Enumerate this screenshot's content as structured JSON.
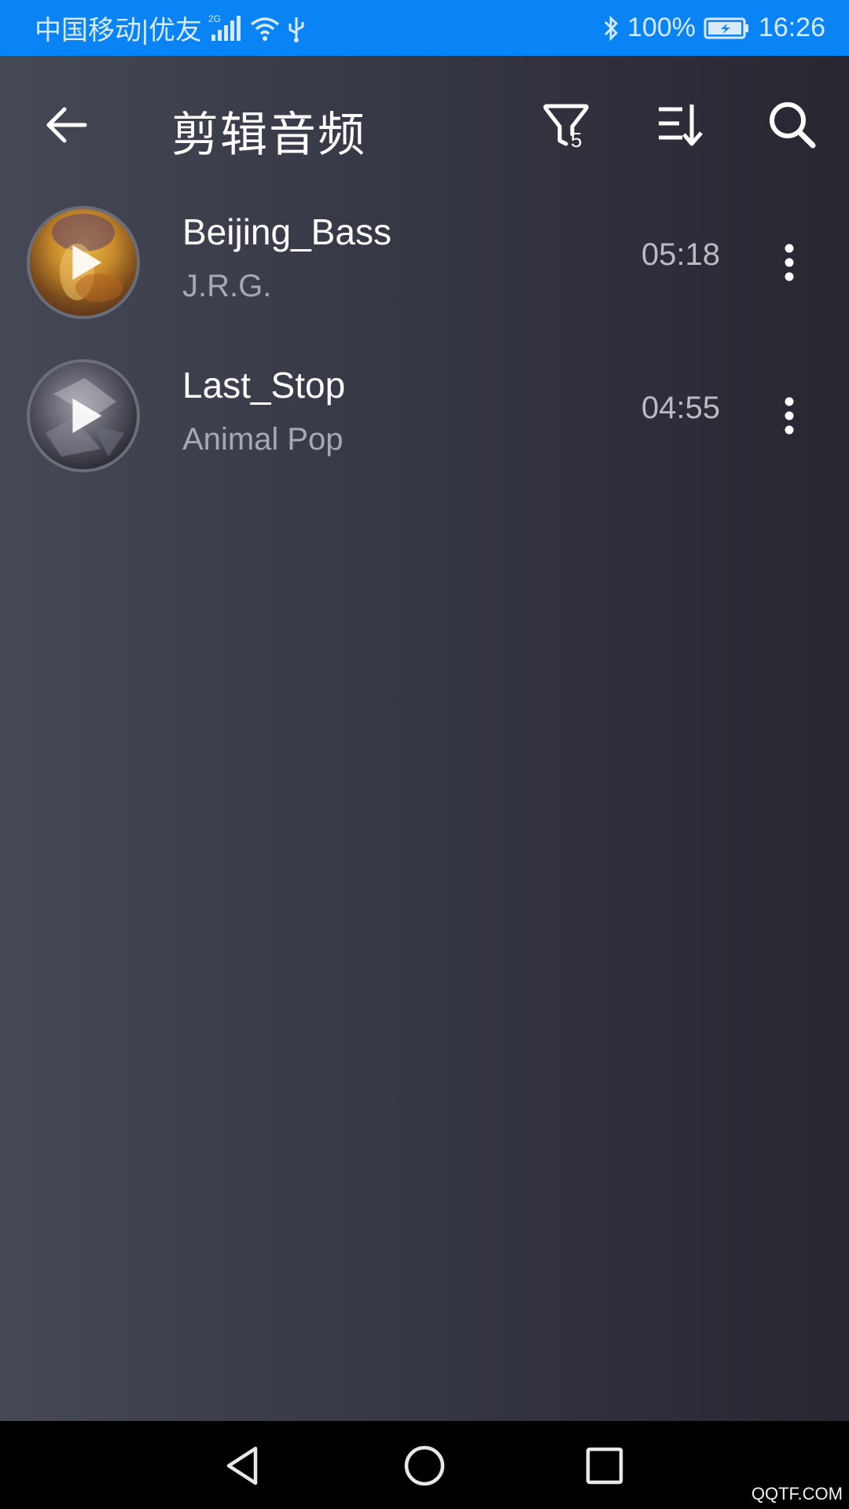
{
  "status_bar": {
    "carrier": "中国移动|优友",
    "network_type": "2G",
    "battery": "100%",
    "time": "16:26",
    "color": "#0a84f4"
  },
  "app_bar": {
    "title": "剪辑音频",
    "filter_count": "5",
    "icons": [
      "back-arrow-icon",
      "filter-icon",
      "sort-icon",
      "search-icon"
    ]
  },
  "tracks": [
    {
      "title": "Beijing_Bass",
      "artist": "J.R.G.",
      "duration": "05:18"
    },
    {
      "title": "Last_Stop",
      "artist": "Animal Pop",
      "duration": "04:55"
    }
  ],
  "nav_bar": {
    "icons": [
      "back-triangle-icon",
      "home-circle-icon",
      "recents-square-icon"
    ]
  },
  "watermark": "QQTF.COM"
}
